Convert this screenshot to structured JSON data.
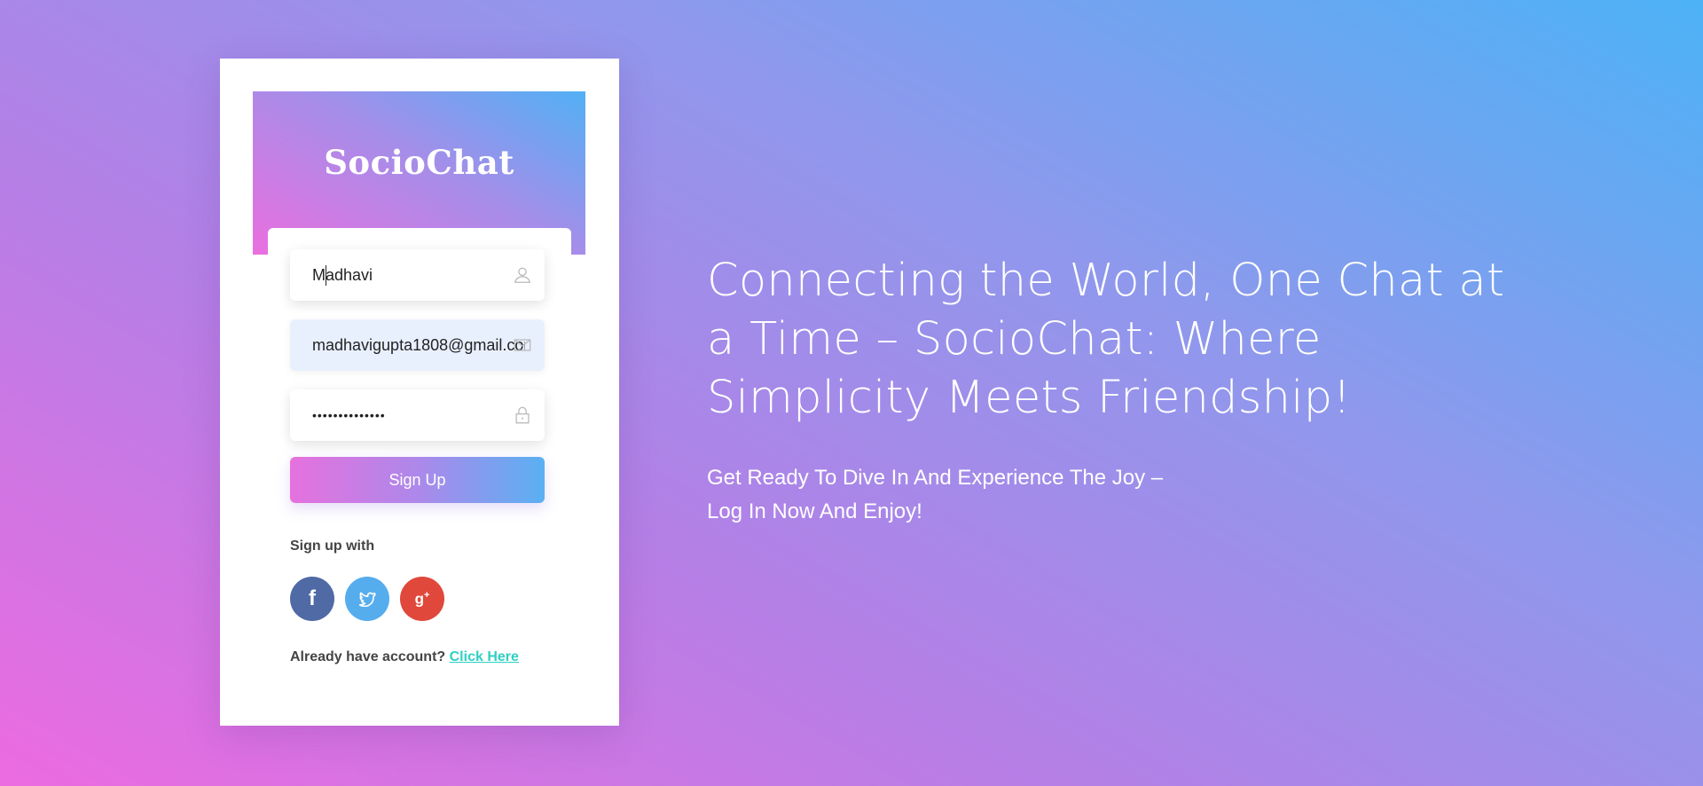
{
  "brand": {
    "name": "SocioChat"
  },
  "form": {
    "name_value": "Madhavi",
    "email_value": "madhavigupta1808@gmail.com",
    "password_value": "••••••••••••••",
    "signup_label": "Sign Up",
    "signup_with_label": "Sign up with",
    "already_text": "Already have account?",
    "login_link": "Click Here"
  },
  "social": [
    {
      "name": "facebook",
      "color": "#4f6aa5"
    },
    {
      "name": "twitter",
      "color": "#56adee"
    },
    {
      "name": "google-plus",
      "color": "#e0483b"
    }
  ],
  "hero": {
    "title": "Connecting the World, One Chat at a Time – SocioChat: Where Simplicity Meets Friendship!",
    "subtitle": "Get Ready To Dive In And Experience The Joy – Log In Now And Enjoy!"
  },
  "colors": {
    "gradient_pink": "#ec6be0",
    "gradient_blue": "#4db2f6",
    "link": "#2fd0c4"
  }
}
